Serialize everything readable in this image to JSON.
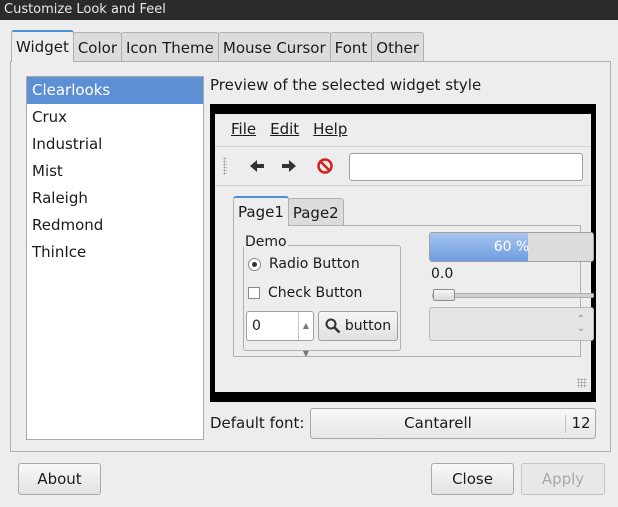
{
  "window": {
    "title": "Customize Look and Feel"
  },
  "tabs": [
    {
      "label": "Widget",
      "active": true
    },
    {
      "label": "Color"
    },
    {
      "label": "Icon Theme"
    },
    {
      "label": "Mouse Cursor"
    },
    {
      "label": "Font"
    },
    {
      "label": "Other"
    }
  ],
  "themes": {
    "selected": "Clearlooks",
    "items": [
      "Clearlooks",
      "Crux",
      "Industrial",
      "Mist",
      "Raleigh",
      "Redmond",
      "ThinIce"
    ]
  },
  "preview": {
    "label": "Preview of the selected widget style",
    "menu": [
      "File",
      "Edit",
      "Help"
    ],
    "toolbar_icons": [
      "back-arrow-icon",
      "forward-arrow-icon",
      "stop-icon"
    ],
    "tabs": [
      "Page1",
      "Page2"
    ],
    "demo_label": "Demo",
    "radio_label": "Radio Button",
    "check_label": "Check Button",
    "spin_value": "0",
    "search_button_label": "button",
    "progress_text": "60 %",
    "progress_value": 0.6,
    "scale_value": "0.0"
  },
  "font": {
    "label": "Default font:",
    "name": "Cantarell",
    "size": "12"
  },
  "buttons": {
    "about": "About",
    "close": "Close",
    "apply": "Apply"
  },
  "colors": {
    "selection": "#5d8fd4",
    "progress": "#6d9ee0",
    "stop": "#d42020"
  }
}
